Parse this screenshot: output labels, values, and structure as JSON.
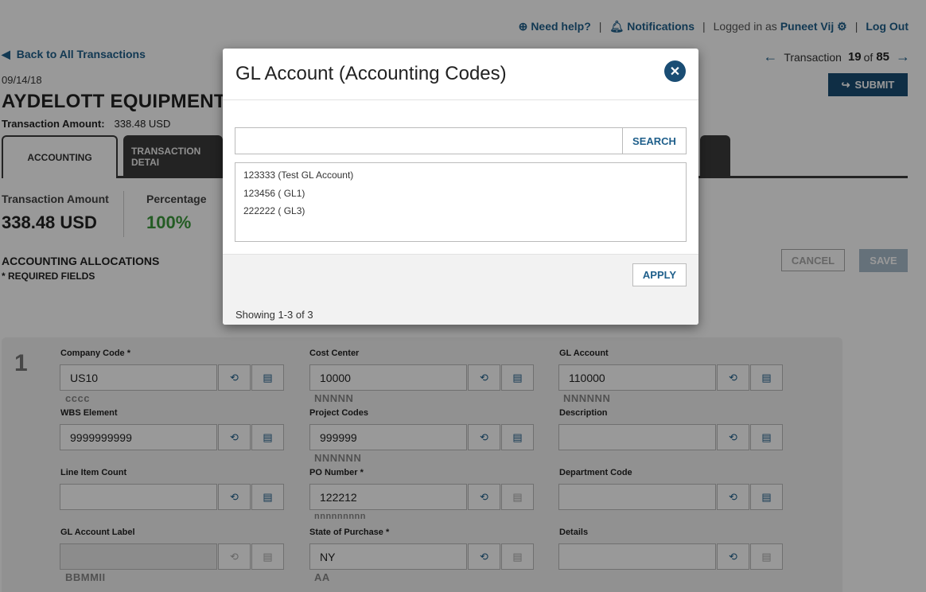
{
  "header": {
    "help": "Need help?",
    "notifications": "Notifications",
    "logged_in_as": "Logged in as",
    "user": "Puneet Vij",
    "logout": "Log Out"
  },
  "back_link": "Back to All Transactions",
  "date": "09/14/18",
  "merchant": "AYDELOTT EQUIPMENT",
  "transaction_amount_label": "Transaction Amount:",
  "transaction_amount_value": "338.48 USD",
  "txn_nav": {
    "prefix": "Transaction",
    "current": "19",
    "of": "of",
    "total": "85"
  },
  "submit_label": "SUBMIT",
  "tabs": [
    {
      "label": "ACCOUNTING"
    },
    {
      "label": "TRANSACTION DETAI"
    }
  ],
  "stats": {
    "amount_label": "Transaction Amount",
    "amount_value": "338.48 USD",
    "percentage_label": "Percentage",
    "percentage_value": "100%"
  },
  "allocations": {
    "title": "ACCOUNTING ALLOCATIONS",
    "required_note": "* REQUIRED FIELDS",
    "cancel_label": "CANCEL",
    "save_label": "SAVE",
    "row_number": "1"
  },
  "fields": {
    "company_code": {
      "label": "Company Code *",
      "value": "US10",
      "hint": "cccc"
    },
    "cost_center": {
      "label": "Cost Center",
      "value": "10000",
      "hint": "NNNNN"
    },
    "gl_account": {
      "label": "GL Account",
      "value": "110000",
      "hint": "NNNNNN"
    },
    "wbs_element": {
      "label": "WBS Element",
      "value": "9999999999",
      "hint": ""
    },
    "project_codes": {
      "label": "Project Codes",
      "value": "999999",
      "hint": "NNNNNN"
    },
    "description": {
      "label": "Description",
      "value": "",
      "hint": ""
    },
    "line_item_count": {
      "label": "Line Item Count",
      "value": "",
      "hint": ""
    },
    "po_number": {
      "label": "PO Number *",
      "value": "122212",
      "hint": "nnnnnnnnn"
    },
    "department_code": {
      "label": "Department Code",
      "value": "",
      "hint": ""
    },
    "gl_account_label": {
      "label": "GL Account Label",
      "value": "",
      "hint": "BBMMII"
    },
    "state_of_purchase": {
      "label": "State of Purchase *",
      "value": "NY",
      "hint": "AA"
    },
    "details": {
      "label": "Details",
      "value": "",
      "hint": ""
    }
  },
  "modal": {
    "title": "GL Account (Accounting Codes)",
    "search_placeholder": "",
    "search_label": "SEARCH",
    "items": [
      "123333 (Test GL Account)",
      "123456 ( GL1)",
      "222222 ( GL3)"
    ],
    "apply_label": "APPLY",
    "showing": "Showing 1-3 of 3"
  },
  "colors": {
    "brand": "#1a4d74",
    "link": "#1f5f8b",
    "success": "#3c9a3c"
  }
}
